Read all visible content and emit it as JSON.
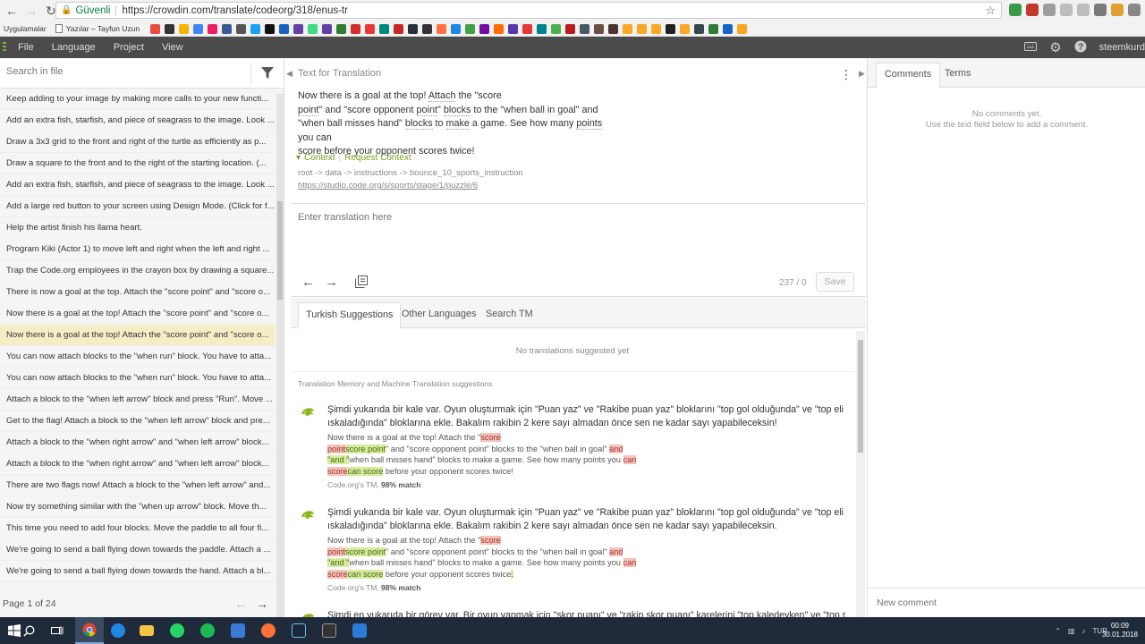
{
  "browser": {
    "secure_label": "Güvenli",
    "url": "https://crowdin.com/translate/codeorg/318/enus-tr",
    "bookmarks": {
      "apps_label": "Uygulamalar",
      "doc_label": "Yazılar – Tayfun Uzun"
    }
  },
  "menubar": {
    "items": [
      "File",
      "Language",
      "Project",
      "View"
    ],
    "username": "steemkurd"
  },
  "left": {
    "search_placeholder": "Search in file",
    "strings": [
      "Keep adding to your image by making more calls to your new functi...",
      "Add an extra fish, starfish, and piece of seagrass to the image. Look ...",
      "Draw a 3x3 grid to the front and right of the turtle as efficiently as p...",
      "Draw a square to the front and to the right of the starting location. (...",
      "Add an extra fish, starfish, and piece of seagrass to the image. Look ...",
      "Add a large red button to your screen using Design Mode. (Click for f...",
      "Help the artist finish his llama heart.",
      "Program Kiki (Actor 1) to move left and right when the left and right ...",
      "Trap the Code.org employees in the crayon box by drawing a square...",
      "There is now a goal at the top. Attach the \"score point\" and \"score o...",
      "Now there is a goal at the top! Attach the \"score point\" and \"score o...",
      "Now there is a goal at the top! Attach the \"score point\" and \"score o...",
      "You can now attach blocks to the \"when run\" block. You have to atta...",
      "You can now attach blocks to the \"when run\" block. You have to atta...",
      "Attach a block to the \"when left arrow\" block and press \"Run\". Move ...",
      "Get to the flag! Attach a block to the \"when left arrow\" block and pre...",
      "Attach a block to the \"when right arrow\" and \"when left arrow\" block...",
      "Attach a block to the \"when right arrow\" and \"when left arrow\" block...",
      "There are two flags now! Attach a block to the \"when left arrow\" and...",
      "Now try something similar with the \"when up arrow\" block. Move th...",
      "This time you need to add four blocks. Move the paddle to all four fi...",
      "We're going to send a ball flying down towards the paddle. Attach a ...",
      "We're going to send a ball flying down towards the hand. Attach a bl..."
    ],
    "active_index": 11,
    "page_label": "Page 1 of 24"
  },
  "source": {
    "title": "Text for Translation",
    "text_lines": [
      [
        "Now there is a goal at the top! ",
        "Attach",
        " the \"score"
      ],
      [
        "point",
        "\" and \"score opponent ",
        "point",
        "\" ",
        "blocks",
        " to the \"when ball in goal\" and"
      ],
      [
        "\"when ball misses hand\" ",
        "blocks",
        " to ",
        "make",
        " a game. See how many ",
        "points",
        " you can"
      ],
      [
        "score before your opponent scores twice!"
      ]
    ],
    "context_label": "Context",
    "request_context_label": "Request Context",
    "context_path": "root -> data -> instructions -> bounce_10_sports_instruction",
    "context_link": "https://studio.code.org/s/sports/stage/1/puzzle/6"
  },
  "translation": {
    "placeholder": "Enter translation here",
    "counter": "237 / 0",
    "save_label": "Save"
  },
  "suggestions": {
    "tabs": [
      "Turkish Suggestions",
      "Other Languages",
      "Search TM"
    ],
    "no_translations": "No translations suggested yet",
    "tm_header": "Translation Memory and Machine Translation suggestions",
    "entries": [
      {
        "text": "Şimdi yukarıda bir kale var. Oyun oluşturmak için \"Puan yaz\" ve \"Rakibe puan yaz\" bloklarını \"top gol olduğunda\" ve \"top eli ıskaladığında\" bloklarına ekle. Bakalım rakibin 2 kere sayı almadan önce sen ne kadar sayı yapabileceksin!",
        "meta_source": "Code.org's TM, ",
        "meta_match": "98% match"
      },
      {
        "text": "Şimdi yukarıda bir kale var. Oyun oluşturmak için \"Puan yaz\" ve \"Rakibe puan yaz\" bloklarını \"top gol olduğunda\" ve \"top eli ıskaladığında\" bloklarına ekle. Bakalım rakibin 2 kere sayı almadan önce sen ne kadar sayı yapabileceksin.",
        "meta_source": "Code.org's TM, ",
        "meta_match": "98% match"
      },
      {
        "text": "Şimdi en yukarıda bir görev var. Bir oyun yapmak için \"skor puanı\" ve \"rakip skor puanı\" karelerini \"top kaledeyken\" ve \"top raketi"
      }
    ],
    "diff": {
      "l1a": "Now there is a goal at the top! Attach the \"",
      "l1del": "score",
      "l2del": "point",
      "l2ins": "score point",
      "l2b": "\" and \"score opponent point\" blocks to the \"when ball in goal\" ",
      "l2del2": "and",
      "l3ins": "\"and \"",
      "l3b": "when ball misses hand\" blocks to make a game. See how many points you ",
      "l3del": "can",
      "l4del": "score",
      "l4ins": "can score",
      "l4b": " before your opponent scores twice",
      "l4end1": "!",
      "l4end2": "."
    }
  },
  "right": {
    "tabs": [
      "Comments",
      "Terms"
    ],
    "no_comments": "No comments yet.",
    "hint": "Use the text field below to add a comment.",
    "comment_placeholder": "New comment"
  },
  "taskbar": {
    "lang": "TUR",
    "time": "00:09",
    "date": "30.01.2018"
  }
}
